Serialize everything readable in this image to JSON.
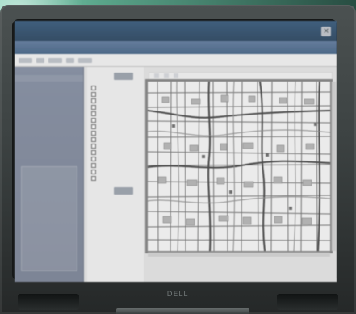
{
  "window": {
    "close_icon": "×"
  },
  "app": {
    "header_label": "",
    "toolbar_labels": [
      "",
      "",
      "",
      "",
      ""
    ]
  },
  "sidebar": {
    "items": [
      {
        "label": ""
      },
      {
        "label": ""
      },
      {
        "label": ""
      },
      {
        "label": ""
      }
    ]
  },
  "layers": {
    "items": [
      {
        "label": ""
      },
      {
        "label": ""
      },
      {
        "label": ""
      },
      {
        "label": ""
      },
      {
        "label": ""
      },
      {
        "label": ""
      },
      {
        "label": ""
      },
      {
        "label": ""
      },
      {
        "label": ""
      },
      {
        "label": ""
      },
      {
        "label": ""
      },
      {
        "label": ""
      },
      {
        "label": ""
      },
      {
        "label": ""
      },
      {
        "label": ""
      }
    ]
  },
  "map": {
    "tabs": [
      "",
      "",
      ""
    ]
  },
  "device": {
    "brand": "DELL"
  }
}
